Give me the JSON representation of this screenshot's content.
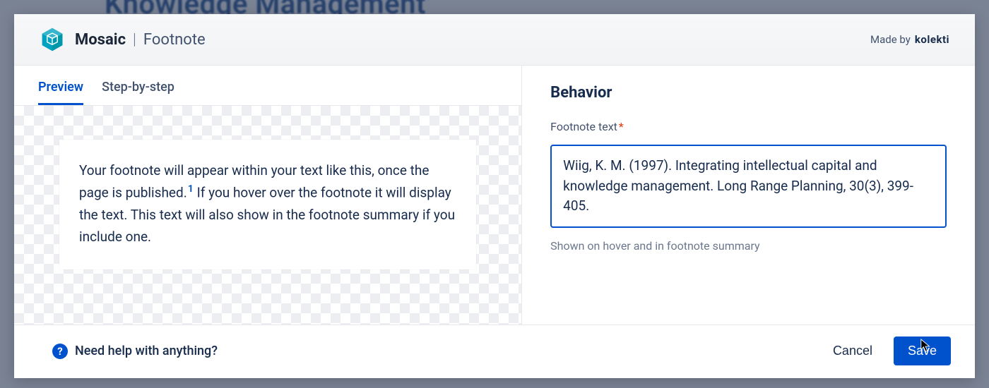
{
  "backdrop": {
    "title": "Knowledge Management"
  },
  "header": {
    "brand": "Mosaic",
    "divider": "|",
    "sub": "Footnote",
    "made_by_prefix": "Made by",
    "made_by_brand": "kolekti"
  },
  "tabs": {
    "preview": "Preview",
    "step_by_step": "Step-by-step",
    "active": "preview"
  },
  "preview": {
    "text_before_sup": "Your footnote will appear within your text like this, once the page is published.",
    "sup": "1",
    "text_after_sup": "  If you hover over the footnote it will display the text. This text will also show in the footnote summary if you include one."
  },
  "behavior": {
    "heading": "Behavior",
    "field_label": "Footnote text",
    "required_marker": "*",
    "value": "Wiig, K. M. (1997). Integrating intellectual capital and knowledge management. Long Range Planning, 30(3), 399-405.",
    "help": "Shown on hover and in footnote summary"
  },
  "footer": {
    "help_icon_glyph": "?",
    "help_text": "Need help with anything?",
    "cancel": "Cancel",
    "save": "Save"
  },
  "colors": {
    "primary": "#0052cc",
    "text": "#172b4d",
    "muted": "#6b778c",
    "danger": "#de350b"
  }
}
